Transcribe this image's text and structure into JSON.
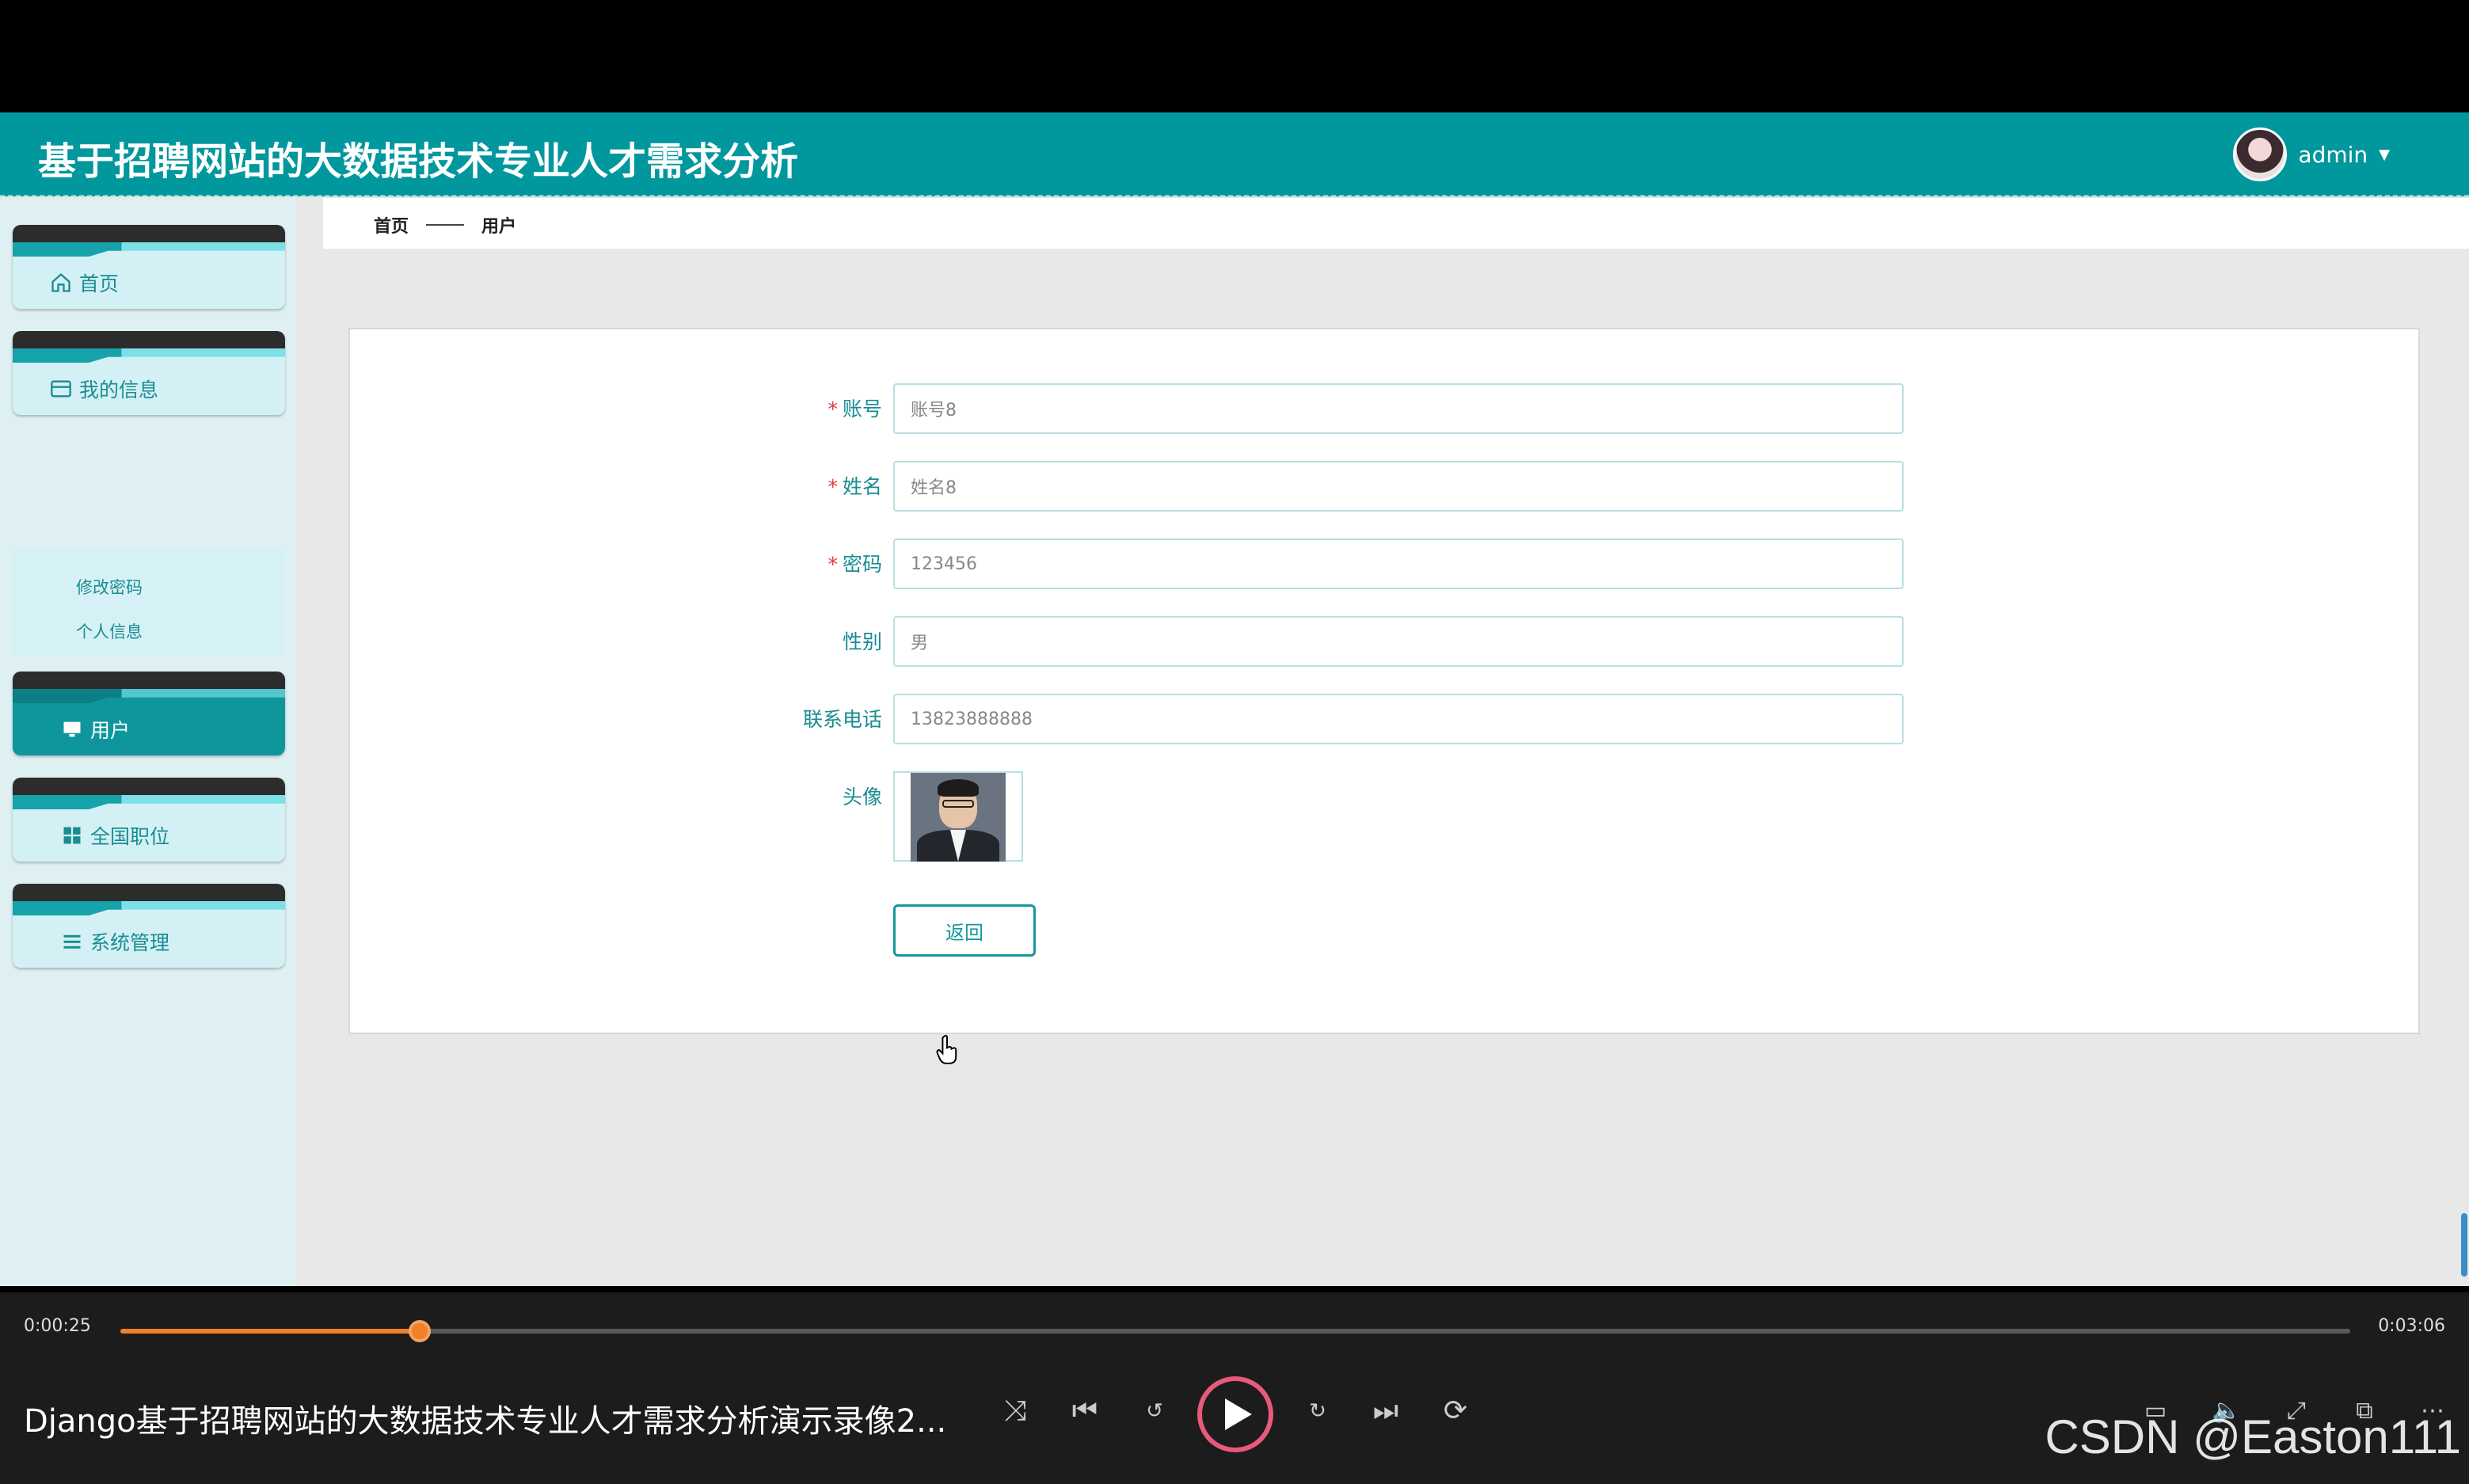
{
  "app": {
    "title": "基于招聘网站的大数据技术专业人才需求分析",
    "user_name": "admin"
  },
  "sidebar": {
    "items": [
      {
        "label": "首页",
        "icon": "home-icon"
      },
      {
        "label": "我的信息",
        "icon": "card-icon"
      },
      {
        "label": "用户",
        "icon": "monitor-icon"
      },
      {
        "label": "全国职位",
        "icon": "grid-icon"
      },
      {
        "label": "系统管理",
        "icon": "list-icon"
      }
    ],
    "sub_items": [
      "修改密码",
      "个人信息"
    ]
  },
  "breadcrumb": {
    "home": "首页",
    "current": "用户"
  },
  "form": {
    "fields": [
      {
        "label": "账号",
        "required": true,
        "value": "账号8"
      },
      {
        "label": "姓名",
        "required": true,
        "value": "姓名8"
      },
      {
        "label": "密码",
        "required": true,
        "value": "123456"
      },
      {
        "label": "性别",
        "required": false,
        "value": "男"
      },
      {
        "label": "联系电话",
        "required": false,
        "value": "13823888888"
      }
    ],
    "avatar_label": "头像",
    "back_button": "返回",
    "required_mark": "*"
  },
  "player": {
    "current_time": "0:00:25",
    "total_time": "0:03:06",
    "progress": 0.1344,
    "title": "Django基于招聘网站的大数据技术专业人才需求分析演示录像2...",
    "watermark": "CSDN @Easton111"
  },
  "colors": {
    "header": "#00979d",
    "accent": "#1a8c93",
    "progress": "#f07f28"
  }
}
